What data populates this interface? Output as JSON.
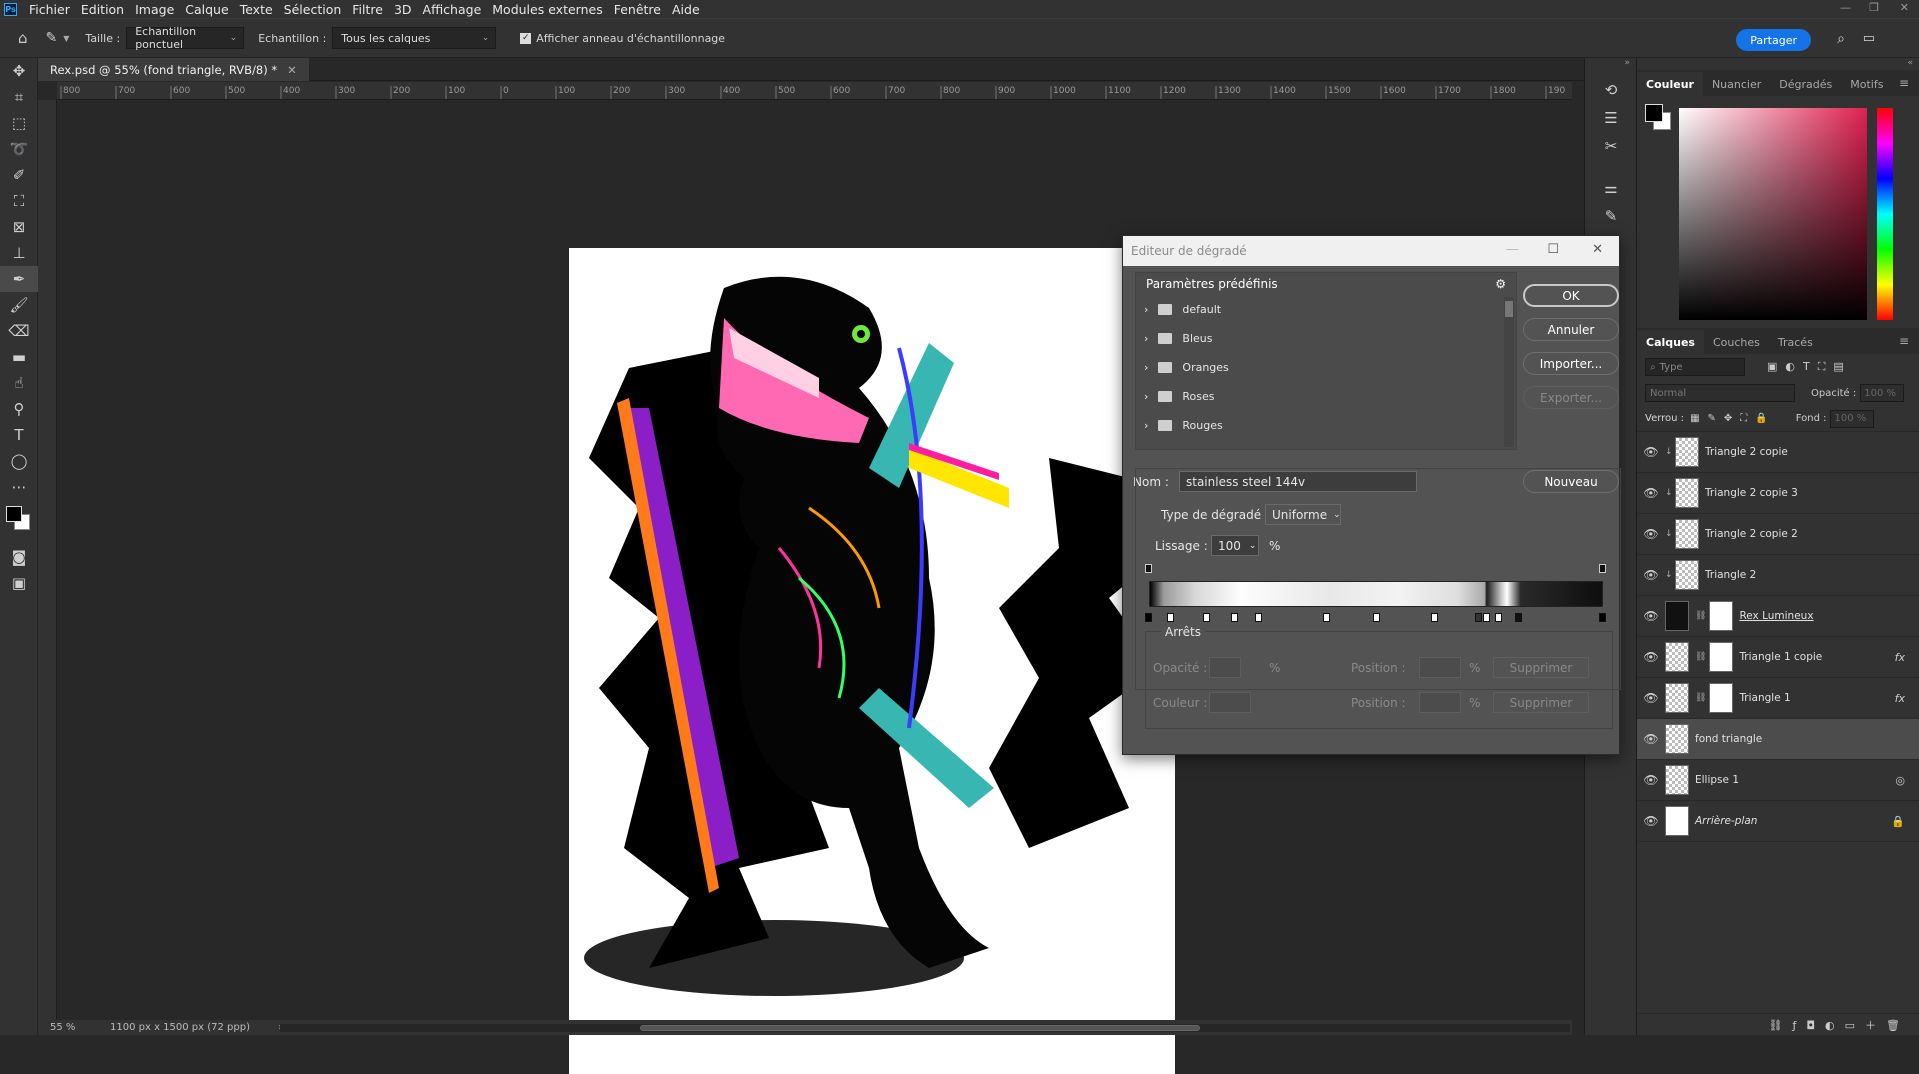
{
  "menu": {
    "items": [
      "Fichier",
      "Edition",
      "Image",
      "Calque",
      "Texte",
      "Sélection",
      "Filtre",
      "3D",
      "Affichage",
      "Modules externes",
      "Fenêtre",
      "Aide"
    ]
  },
  "options": {
    "taille_label": "Taille :",
    "taille_value": "Echantillon ponctuel",
    "echantillon_label": "Echantillon :",
    "echantillon_value": "Tous les calques",
    "ring_label": "Afficher anneau d'échantillonnage",
    "share": "Partager"
  },
  "document": {
    "tab_title": "Rex.psd @ 55% (fond triangle, RVB/8) *",
    "zoom": "55 %",
    "size": "1100 px x 1500 px (72 ppp)"
  },
  "ruler": {
    "h_ticks": [
      "800",
      "700",
      "600",
      "500",
      "400",
      "300",
      "200",
      "100",
      "0",
      "100",
      "200",
      "300",
      "400",
      "500",
      "600",
      "700",
      "800",
      "900",
      "1000",
      "1100",
      "1200",
      "1300",
      "1400",
      "1500",
      "1600",
      "1700",
      "1800",
      "190"
    ]
  },
  "color_panel": {
    "tabs": [
      "Couleur",
      "Nuancier",
      "Dégradés",
      "Motifs"
    ]
  },
  "layers_panel": {
    "tabs": [
      "Calques",
      "Couches",
      "Tracés"
    ],
    "filter": "Type",
    "mode": "Normal",
    "opacity_label": "Opacité :",
    "opacity": "100 %",
    "lock_label": "Verrou :",
    "fill_label": "Fond :",
    "fill": "100 %",
    "layers": [
      {
        "name": "Triangle 2 copie",
        "fx": ""
      },
      {
        "name": "Triangle 2 copie 3",
        "fx": ""
      },
      {
        "name": "Triangle 2 copie 2",
        "fx": ""
      },
      {
        "name": "Triangle 2",
        "fx": ""
      },
      {
        "name": "Rex Lumineux",
        "fx": ""
      },
      {
        "name": "Triangle 1 copie",
        "fx": "fx"
      },
      {
        "name": "Triangle 1",
        "fx": "fx"
      },
      {
        "name": "fond triangle",
        "fx": ""
      },
      {
        "name": "Ellipse 1",
        "fx": ""
      },
      {
        "name": "Arrière-plan",
        "fx": ""
      }
    ]
  },
  "gradient_editor": {
    "title": "Editeur de dégradé",
    "presets_label": "Paramètres prédéfinis",
    "presets": [
      "default",
      "Bleus",
      "Oranges",
      "Roses",
      "Rouges"
    ],
    "buttons": {
      "ok": "OK",
      "cancel": "Annuler",
      "import": "Importer...",
      "export": "Exporter...",
      "new": "Nouveau"
    },
    "name_label": "Nom :",
    "name_value": "stainless steel 144v",
    "type_label": "Type de dégradé :",
    "type_value": "Uniforme",
    "smooth_label": "Lissage :",
    "smooth_value": "100",
    "percent": "%",
    "stops_label": "Arrêts",
    "opacity_label": "Opacité :",
    "position_label": "Position :",
    "color_label": "Couleur :",
    "delete": "Supprimer"
  },
  "colors": {
    "accent": "#1473e6",
    "panel": "#323232",
    "dialog": "#535353"
  }
}
